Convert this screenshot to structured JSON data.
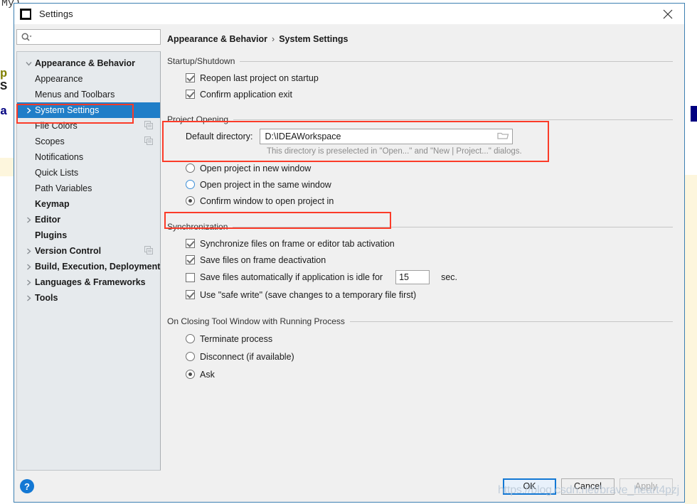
{
  "background": {
    "fragments": [
      "My)",
      "p",
      "S",
      "a"
    ]
  },
  "window": {
    "title": "Settings",
    "logo_icon": "intellij-idea-logo-icon",
    "close_icon": "close-icon"
  },
  "search": {
    "icon": "search-icon",
    "value": "",
    "placeholder": ""
  },
  "sidebar": {
    "items": [
      {
        "label": "Appearance & Behavior",
        "level": 0,
        "arrow": "expanded",
        "selected": false,
        "copy_icon": false
      },
      {
        "label": "Appearance",
        "level": 1,
        "arrow": "none",
        "selected": false,
        "copy_icon": false
      },
      {
        "label": "Menus and Toolbars",
        "level": 1,
        "arrow": "none",
        "selected": false,
        "copy_icon": false
      },
      {
        "label": "System Settings",
        "level": 1,
        "arrow": "collapsed",
        "selected": true,
        "copy_icon": false
      },
      {
        "label": "File Colors",
        "level": 1,
        "arrow": "none",
        "selected": false,
        "copy_icon": true
      },
      {
        "label": "Scopes",
        "level": 1,
        "arrow": "none",
        "selected": false,
        "copy_icon": true
      },
      {
        "label": "Notifications",
        "level": 1,
        "arrow": "none",
        "selected": false,
        "copy_icon": false
      },
      {
        "label": "Quick Lists",
        "level": 1,
        "arrow": "none",
        "selected": false,
        "copy_icon": false
      },
      {
        "label": "Path Variables",
        "level": 1,
        "arrow": "none",
        "selected": false,
        "copy_icon": false
      },
      {
        "label": "Keymap",
        "level": 0,
        "arrow": "none",
        "selected": false,
        "copy_icon": false
      },
      {
        "label": "Editor",
        "level": 0,
        "arrow": "collapsed",
        "selected": false,
        "copy_icon": false
      },
      {
        "label": "Plugins",
        "level": 0,
        "arrow": "none",
        "selected": false,
        "copy_icon": false
      },
      {
        "label": "Version Control",
        "level": 0,
        "arrow": "collapsed",
        "selected": false,
        "copy_icon": true
      },
      {
        "label": "Build, Execution, Deployment",
        "level": 0,
        "arrow": "collapsed",
        "selected": false,
        "copy_icon": false
      },
      {
        "label": "Languages & Frameworks",
        "level": 0,
        "arrow": "collapsed",
        "selected": false,
        "copy_icon": false
      },
      {
        "label": "Tools",
        "level": 0,
        "arrow": "collapsed",
        "selected": false,
        "copy_icon": false
      }
    ]
  },
  "breadcrumb": {
    "parent": "Appearance & Behavior",
    "separator": "›",
    "current": "System Settings"
  },
  "startup_shutdown": {
    "title": "Startup/Shutdown",
    "options": [
      {
        "label": "Reopen last project on startup",
        "checked": true
      },
      {
        "label": "Confirm application exit",
        "checked": true
      }
    ]
  },
  "project_opening": {
    "title": "Project Opening",
    "default_directory_label": "Default directory:",
    "default_directory_value": "D:\\IDEAWorkspace",
    "browse_icon": "folder-icon",
    "hint": "This directory is preselected in \"Open...\" and \"New | Project...\" dialogs.",
    "radios": [
      {
        "label": "Open project in new window",
        "selected": false,
        "focused": false
      },
      {
        "label": "Open project in the same window",
        "selected": false,
        "focused": true
      },
      {
        "label": "Confirm window to open project in",
        "selected": true,
        "focused": false
      }
    ]
  },
  "synchronization": {
    "title": "Synchronization",
    "options": [
      {
        "label": "Synchronize files on frame or editor tab activation",
        "checked": true
      },
      {
        "label": "Save files on frame deactivation",
        "checked": true
      },
      {
        "label": "Save files automatically if application is idle for",
        "checked": false
      },
      {
        "label": "Use \"safe write\" (save changes to a temporary file first)",
        "checked": true
      }
    ],
    "idle_seconds_value": "15",
    "idle_seconds_unit": "sec."
  },
  "tool_window_closing": {
    "title": "On Closing Tool Window with Running Process",
    "radios": [
      {
        "label": "Terminate process",
        "selected": false
      },
      {
        "label": "Disconnect (if available)",
        "selected": false
      },
      {
        "label": "Ask",
        "selected": true
      }
    ]
  },
  "footer": {
    "help_icon": "help-question-icon",
    "help_label": "?",
    "ok_label": "OK",
    "cancel_label": "Cancel",
    "apply_label": "Apply"
  },
  "watermark": {
    "text": "https://blog.csdn.net/brave_heart4pzj"
  },
  "colors": {
    "selection_blue": "#1f7ec8",
    "annotation_red": "#fb3b28",
    "dialog_border": "#3c7fb1",
    "tree_bg": "#e6eaed",
    "panel_bg": "#f0f0f0",
    "accent_button": "#1378d4"
  }
}
